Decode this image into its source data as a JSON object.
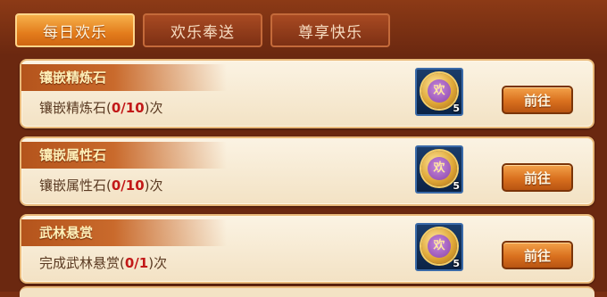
{
  "tabs": [
    {
      "label": "每日欢乐",
      "active": true
    },
    {
      "label": "欢乐奉送",
      "active": false
    },
    {
      "label": "尊享快乐",
      "active": false
    }
  ],
  "tasks": [
    {
      "title": "镶嵌精炼石",
      "desc_prefix": "镶嵌精炼石(",
      "progress": "0/10",
      "desc_suffix": ")次",
      "reward_icon": "coin-icon",
      "reward_symbol": "欢",
      "reward_qty": "5",
      "button": "前往"
    },
    {
      "title": "镶嵌属性石",
      "desc_prefix": "镶嵌属性石(",
      "progress": "0/10",
      "desc_suffix": ")次",
      "reward_icon": "coin-icon",
      "reward_symbol": "欢",
      "reward_qty": "5",
      "button": "前往"
    },
    {
      "title": "武林悬赏",
      "desc_prefix": "完成武林悬赏(",
      "progress": "0/1",
      "desc_suffix": ")次",
      "reward_icon": "coin-icon",
      "reward_symbol": "欢",
      "reward_qty": "5",
      "button": "前往"
    }
  ],
  "colors": {
    "progress": "#c21818",
    "accent": "#e37c1c"
  }
}
